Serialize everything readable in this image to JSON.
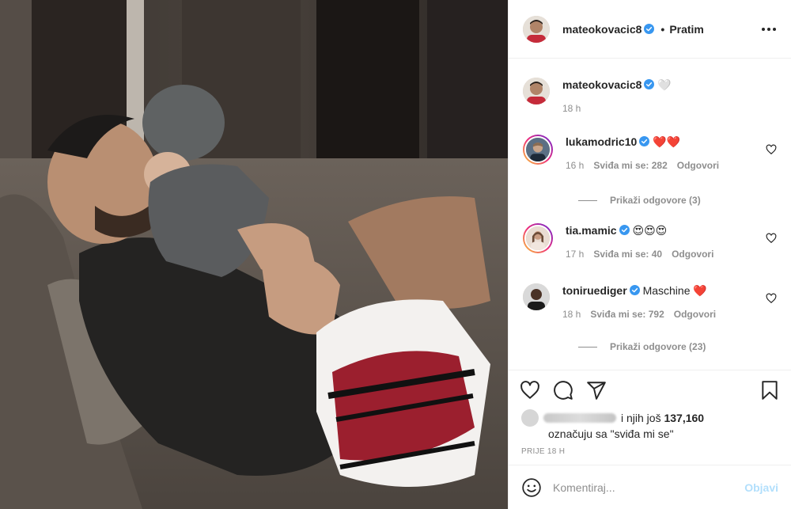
{
  "post": {
    "author": "mateokovacic8",
    "follow_dot": "•",
    "follow_label": "Pratim",
    "caption_emoji": "🤍",
    "caption_time": "18 h"
  },
  "comments": [
    {
      "user": "lukamodric10",
      "text": "❤️❤️",
      "time": "16 h",
      "likes": "Sviđa mi se: 282",
      "reply": "Odgovori",
      "view_replies": "Prikaži odgovore (3)"
    },
    {
      "user": "tia.mamic",
      "text": "😍😍😍",
      "time": "17 h",
      "likes": "Sviđa mi se: 40",
      "reply": "Odgovori"
    },
    {
      "user": "toniruediger",
      "text": "Maschine ❤️",
      "time": "18 h",
      "likes": "Sviđa mi se: 792",
      "reply": "Odgovori",
      "view_replies": "Prikaži odgovore (23)"
    }
  ],
  "likes": {
    "prefix": "i njih još",
    "count": "137,160",
    "suffix": "označuju sa \"sviđa mi se\""
  },
  "timestamp": "PRIJE 18 H",
  "composer": {
    "placeholder": "Komentiraj...",
    "post_label": "Objavi"
  },
  "colors": {
    "verified": "#3897f0",
    "post_button_disabled": "#b2dffc",
    "secondary_text": "#8e8e8e"
  }
}
